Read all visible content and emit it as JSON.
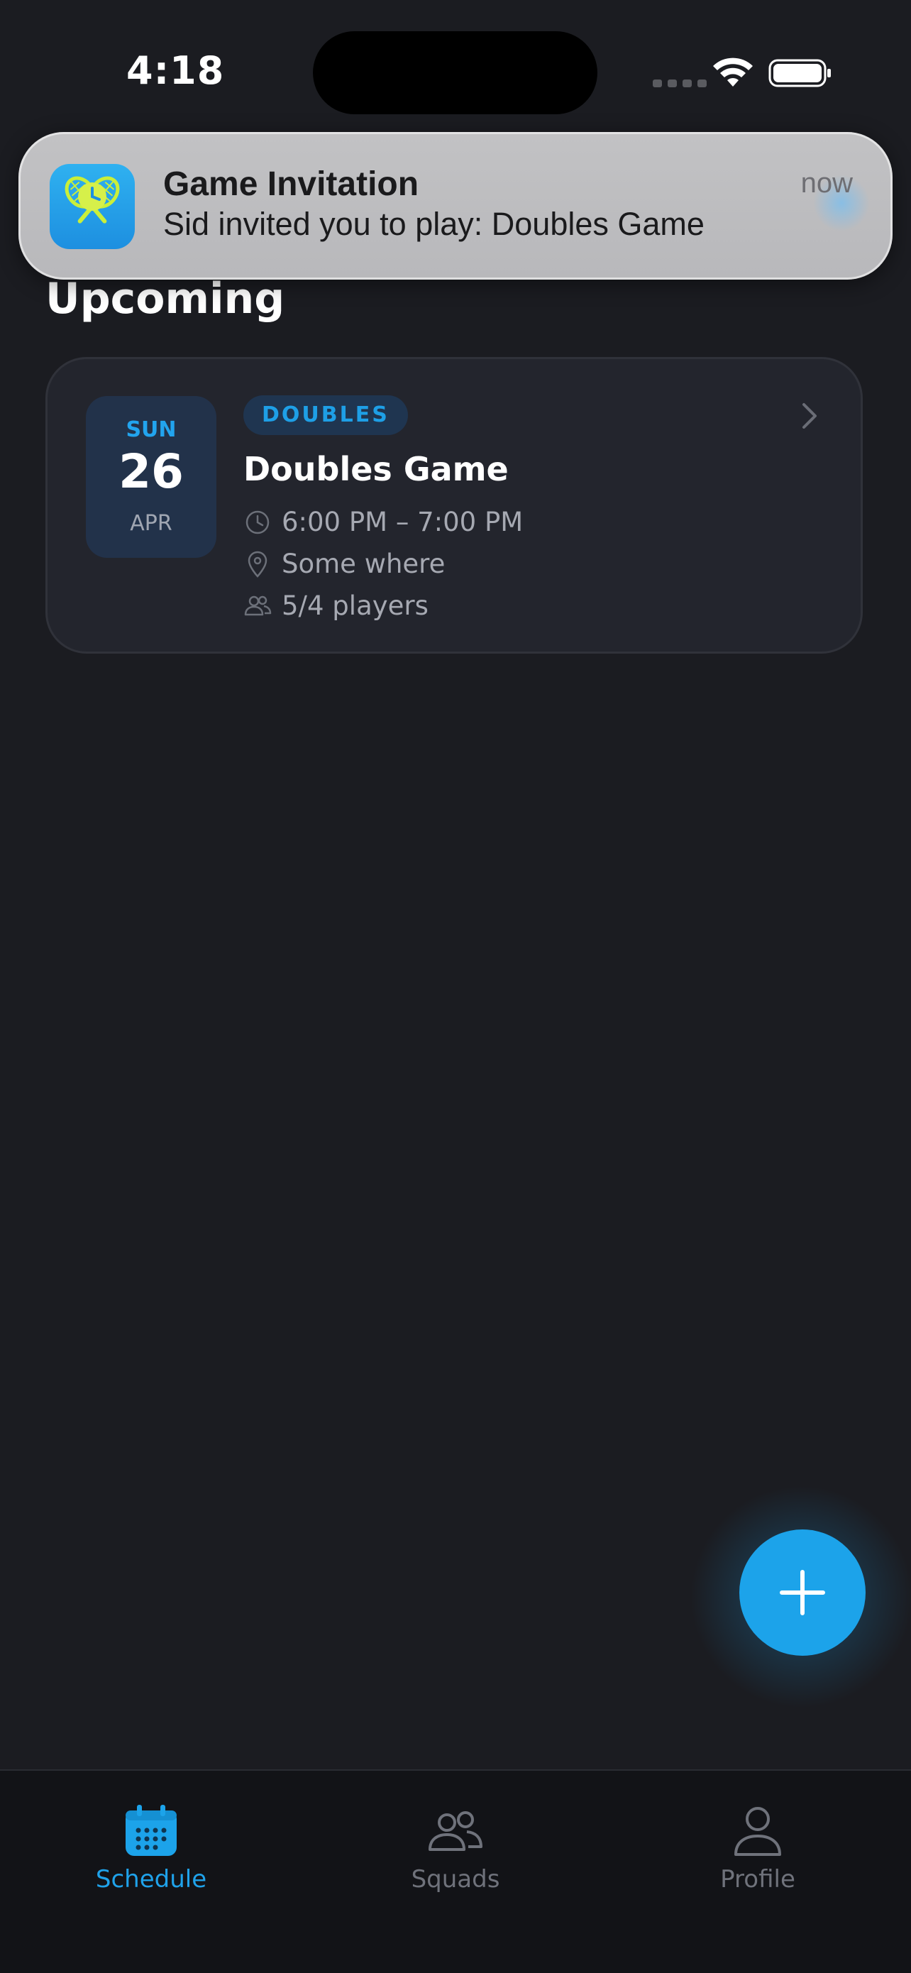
{
  "status_bar": {
    "time": "4:18"
  },
  "notification": {
    "title": "Game Invitation",
    "body": "Sid invited you to play: Doubles Game",
    "time": "now"
  },
  "section": {
    "title": "Upcoming"
  },
  "event": {
    "date": {
      "day_of_week": "SUN",
      "day": "26",
      "month": "APR"
    },
    "type_badge": "DOUBLES",
    "title": "Doubles Game",
    "time_range": "6:00 PM – 7:00 PM",
    "location": "Some where",
    "players": "5/4 players"
  },
  "tabs": [
    {
      "label": "Schedule",
      "icon": "calendar-icon",
      "active": true
    },
    {
      "label": "Squads",
      "icon": "people-icon",
      "active": false
    },
    {
      "label": "Profile",
      "icon": "person-icon",
      "active": false
    }
  ],
  "colors": {
    "background": "#1b1c21",
    "accent": "#1ca3ea",
    "card": "#23252d",
    "tabbar": "#121317"
  }
}
